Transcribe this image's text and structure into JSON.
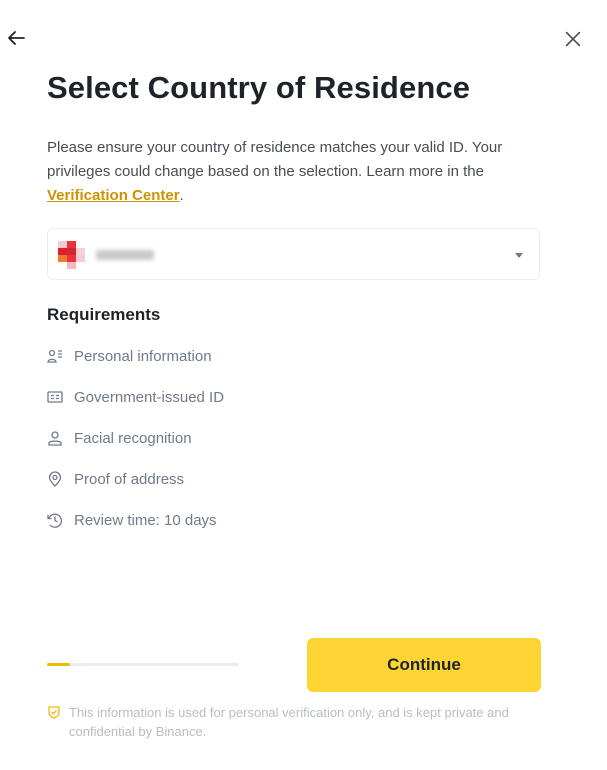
{
  "nav": {
    "back_icon": "arrow-left-icon",
    "close_icon": "close-icon"
  },
  "header": {
    "title": "Select Country of Residence"
  },
  "description": {
    "text": "Please ensure your country of residence matches your valid ID. Your privileges could change based on the selection. Learn more in the ",
    "link_label": "Verification Center",
    "suffix": "."
  },
  "country_select": {
    "value": "",
    "caret_icon": "caret-down-icon"
  },
  "requirements": {
    "title": "Requirements",
    "items": [
      {
        "icon": "personal-info-icon",
        "label": "Personal information"
      },
      {
        "icon": "id-card-icon",
        "label": "Government-issued ID"
      },
      {
        "icon": "face-icon",
        "label": "Facial recognition"
      },
      {
        "icon": "location-pin-icon",
        "label": "Proof of address"
      },
      {
        "icon": "clock-icon",
        "label": "Review time: 10 days"
      }
    ]
  },
  "progress": {
    "fraction": 0.12
  },
  "actions": {
    "continue_label": "Continue"
  },
  "footer": {
    "note": "This information is used for personal verification only, and is kept private and confidential by Binance."
  },
  "colors": {
    "accent": "#FCD535",
    "link": "#C99400",
    "progress": "#F0B90B",
    "text_muted": "#707A8A"
  }
}
